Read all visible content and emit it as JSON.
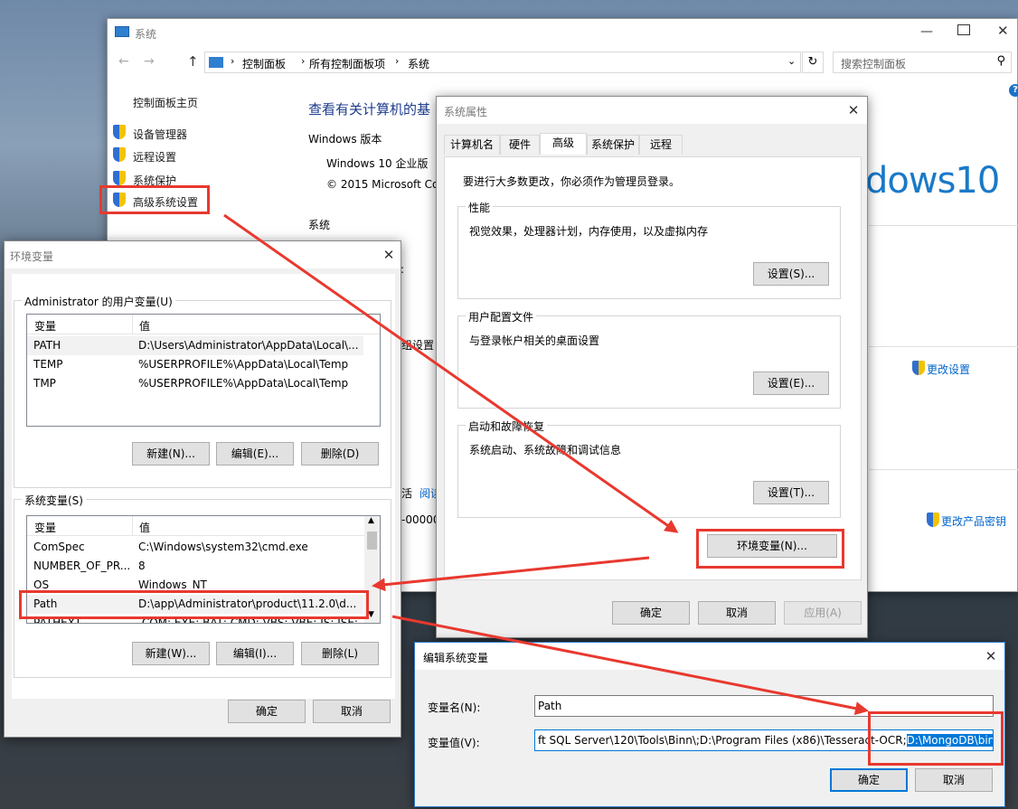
{
  "system_window": {
    "title": "系统",
    "breadcrumb": [
      "控制面板",
      "所有控制面板项",
      "系统"
    ],
    "search_placeholder": "搜索控制面板",
    "nav_home": "控制面板主页",
    "nav_items": [
      "设备管理器",
      "远程设置",
      "系统保护",
      "高级系统设置"
    ],
    "heading": "查看有关计算机的基",
    "windows_edition_label": "Windows 版本",
    "edition": "Windows 10 企业版",
    "copyright": "© 2015 Microsoft Co",
    "system_label": "系统",
    "brand": "dows10",
    "frag_colon": ":",
    "frag_settings": "组设置",
    "frag_activate": "活",
    "frag_read": "阅读",
    "frag_product": "-00000",
    "change_settings": "更改设置",
    "change_key": "更改产品密钥"
  },
  "sysprops": {
    "title": "系统属性",
    "tabs": [
      "计算机名",
      "硬件",
      "高级",
      "系统保护",
      "远程"
    ],
    "admin_note": "要进行大多数更改，你必须作为管理员登录。",
    "groups": [
      {
        "label": "性能",
        "desc": "视觉效果，处理器计划，内存使用，以及虚拟内存",
        "button": "设置(S)..."
      },
      {
        "label": "用户配置文件",
        "desc": "与登录帐户相关的桌面设置",
        "button": "设置(E)..."
      },
      {
        "label": "启动和故障恢复",
        "desc": "系统启动、系统故障和调试信息",
        "button": "设置(T)..."
      }
    ],
    "env_button": "环境变量(N)...",
    "ok": "确定",
    "cancel": "取消",
    "apply": "应用(A)"
  },
  "envvars": {
    "title": "环境变量",
    "user_group": "Administrator 的用户变量(U)",
    "col_var": "变量",
    "col_val": "值",
    "user_rows": [
      {
        "name": "PATH",
        "value": "D:\\Users\\Administrator\\AppData\\Local\\..."
      },
      {
        "name": "TEMP",
        "value": "%USERPROFILE%\\AppData\\Local\\Temp"
      },
      {
        "name": "TMP",
        "value": "%USERPROFILE%\\AppData\\Local\\Temp"
      }
    ],
    "user_buttons": [
      "新建(N)...",
      "编辑(E)...",
      "删除(D)"
    ],
    "sys_group": "系统变量(S)",
    "sys_rows": [
      {
        "name": "ComSpec",
        "value": "C:\\Windows\\system32\\cmd.exe"
      },
      {
        "name": "NUMBER_OF_PR...",
        "value": "8"
      },
      {
        "name": "OS",
        "value": "Windows_NT"
      },
      {
        "name": "Path",
        "value": "D:\\app\\Administrator\\product\\11.2.0\\d..."
      },
      {
        "name": "PATHEXT",
        "value": ".COM;.EXE;.BAT;.CMD;.VBS;.VBE;.JS;.JSE;..."
      }
    ],
    "sys_buttons": [
      "新建(W)...",
      "编辑(I)...",
      "删除(L)"
    ],
    "ok": "确定",
    "cancel": "取消"
  },
  "edit_var": {
    "title": "编辑系统变量",
    "name_label": "变量名(N):",
    "name_value": "Path",
    "value_label": "变量值(V):",
    "value_plain": "ft SQL Server\\120\\Tools\\Binn\\;D:\\Program Files (x86)\\Tesseract-OCR;",
    "value_selected": "D:\\MongoDB\\bin",
    "ok": "确定",
    "cancel": "取消"
  },
  "colors": {
    "highlight": "#e8392f",
    "accent": "#0078d7",
    "brand_blue": "#1a79c8"
  }
}
